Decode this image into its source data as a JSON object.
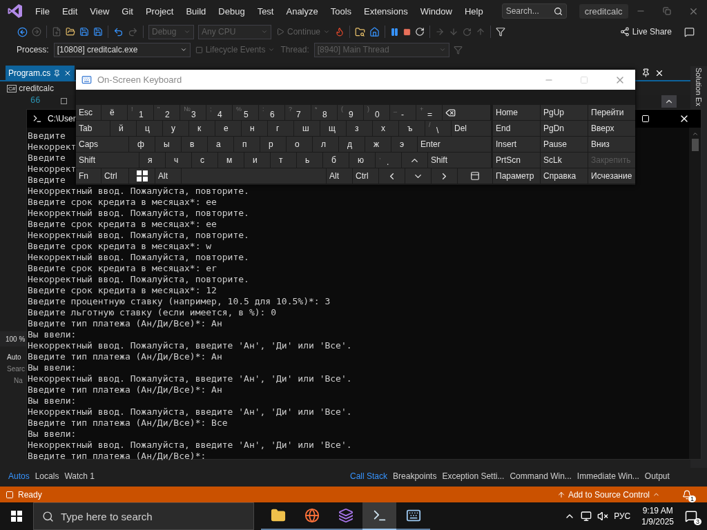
{
  "menu_bar": {
    "items": [
      "File",
      "Edit",
      "View",
      "Git",
      "Project",
      "Build",
      "Debug",
      "Test",
      "Analyze",
      "Tools",
      "Extensions",
      "Window",
      "Help"
    ],
    "search": {
      "placeholder": "Search..."
    },
    "title": "creditcalc"
  },
  "toolbar": {
    "configuration": {
      "value": "Debug",
      "disabled": true
    },
    "platform": {
      "value": "Any CPU",
      "disabled": true
    },
    "continue": {
      "label": "Continue",
      "disabled": true
    },
    "live_share": "Live Share"
  },
  "debug_location": {
    "process_label": "Process:",
    "process": "[10808] creditcalc.exe",
    "lifecycle": {
      "label": "Lifecycle Events",
      "disabled": true
    },
    "thread_label": {
      "label": "Thread:",
      "disabled": true
    },
    "thread": {
      "value": "[8940] Main Thread",
      "disabled": true
    }
  },
  "document_tab": {
    "label": "Program.cs",
    "selected": true
  },
  "navigation": {
    "language_badge": "C#",
    "project": "creditcalc"
  },
  "editor": {
    "line_number": "66",
    "zoom": "100 %"
  },
  "autos_panel": {
    "title": "Auto",
    "search": "Searc",
    "column_1": "Na"
  },
  "solution_explorer": {
    "title": "Solution Ex"
  },
  "bottom_tabs_left": [
    {
      "label": "Autos",
      "selected": true
    },
    {
      "label": "Locals",
      "selected": false
    },
    {
      "label": "Watch 1",
      "selected": false
    }
  ],
  "bottom_tabs_right": [
    {
      "label": "Call Stack",
      "selected": true
    },
    {
      "label": "Breakpoints",
      "selected": false
    },
    {
      "label": "Exception Setti...",
      "selected": false
    },
    {
      "label": "Command Win...",
      "selected": false
    },
    {
      "label": "Immediate Win...",
      "selected": false
    },
    {
      "label": "Output",
      "selected": false
    }
  ],
  "status_bar": {
    "text": "Ready",
    "source_control": "Add to Source Control",
    "notifications": "1"
  },
  "console": {
    "title": "C:\\User",
    "lines": [
      "Введите",
      "Некоррект",
      "Введите",
      "Некоррект",
      "Введите",
      "Некорректный ввод. Пожалуйста, повторите.",
      "Введите срок кредита в месяцах*: ee",
      "Некорректный ввод. Пожалуйста, повторите.",
      "Введите срок кредита в месяцах*: ee",
      "Некорректный ввод. Пожалуйста, повторите.",
      "Введите срок кредита в месяцах*: w",
      "Некорректный ввод. Пожалуйста, повторите.",
      "Введите срок кредита в месяцах*: er",
      "Некорректный ввод. Пожалуйста, повторите.",
      "Введите срок кредита в месяцах*: 12",
      "Введите процентную ставку (например, 10.5 для 10.5%)*: 3",
      "Введите льготную ставку (если имеется, в %): 0",
      "Введите тип платежа (Ан/Ди/Все)*: Ан",
      "Вы ввели:",
      "Некорректный ввод. Пожалуйста, введите 'Ан', 'Ди' или 'Все'.",
      "Введите тип платежа (Ан/Ди/Все)*: Ан",
      "Вы ввели:",
      "Некорректный ввод. Пожалуйста, введите 'Ан', 'Ди' или 'Все'.",
      "Введите тип платежа (Ан/Ди/Все)*: Ан",
      "Вы ввели:",
      "Некорректный ввод. Пожалуйста, введите 'Ан', 'Ди' или 'Все'.",
      "Введите тип платежа (Ан/Ди/Все)*: Все",
      "Вы ввели:",
      "Некорректный ввод. Пожалуйста, введите 'Ан', 'Ди' или 'Все'.",
      "Введите тип платежа (Ан/Ди/Все)*:"
    ]
  },
  "keyboard": {
    "title": "On-Screen Keyboard",
    "rows": [
      [
        {
          "kind": "text",
          "label": "Esc"
        },
        {
          "kind": "char",
          "label": "ё"
        },
        {
          "kind": "char",
          "label": "1",
          "shift": "!"
        },
        {
          "kind": "char",
          "label": "2",
          "shift": "\""
        },
        {
          "kind": "char",
          "label": "3",
          "shift": "№"
        },
        {
          "kind": "char",
          "label": "4",
          "shift": ";"
        },
        {
          "kind": "char",
          "label": "5",
          "shift": "%"
        },
        {
          "kind": "char",
          "label": "6",
          "shift": ":"
        },
        {
          "kind": "char",
          "label": "7",
          "shift": "?"
        },
        {
          "kind": "char",
          "label": "8",
          "shift": "*"
        },
        {
          "kind": "char",
          "label": "9",
          "shift": "("
        },
        {
          "kind": "char",
          "label": "0",
          "shift": ")"
        },
        {
          "kind": "char",
          "label": "-",
          "shift": "_"
        },
        {
          "kind": "char",
          "label": "=",
          "shift": "+"
        },
        {
          "kind": "backspace"
        }
      ],
      [
        {
          "kind": "text",
          "label": "Tab"
        },
        {
          "kind": "char",
          "label": "й"
        },
        {
          "kind": "char",
          "label": "ц"
        },
        {
          "kind": "char",
          "label": "у"
        },
        {
          "kind": "char",
          "label": "к"
        },
        {
          "kind": "char",
          "label": "е"
        },
        {
          "kind": "char",
          "label": "н"
        },
        {
          "kind": "char",
          "label": "г"
        },
        {
          "kind": "char",
          "label": "ш"
        },
        {
          "kind": "char",
          "label": "щ"
        },
        {
          "kind": "char",
          "label": "з"
        },
        {
          "kind": "char",
          "label": "х"
        },
        {
          "kind": "char",
          "label": "ъ"
        },
        {
          "kind": "char",
          "label": "\\",
          "shift": "/"
        },
        {
          "kind": "text",
          "label": "Del"
        }
      ],
      [
        {
          "kind": "text",
          "label": "Caps"
        },
        {
          "kind": "char",
          "label": "ф"
        },
        {
          "kind": "char",
          "label": "ы"
        },
        {
          "kind": "char",
          "label": "в"
        },
        {
          "kind": "char",
          "label": "а"
        },
        {
          "kind": "char",
          "label": "п"
        },
        {
          "kind": "char",
          "label": "р"
        },
        {
          "kind": "char",
          "label": "о"
        },
        {
          "kind": "char",
          "label": "л"
        },
        {
          "kind": "char",
          "label": "д"
        },
        {
          "kind": "char",
          "label": "ж"
        },
        {
          "kind": "char",
          "label": "э"
        },
        {
          "kind": "text",
          "label": "Enter"
        }
      ],
      [
        {
          "kind": "text",
          "label": "Shift"
        },
        {
          "kind": "char",
          "label": "я"
        },
        {
          "kind": "char",
          "label": "ч"
        },
        {
          "kind": "char",
          "label": "с"
        },
        {
          "kind": "char",
          "label": "м"
        },
        {
          "kind": "char",
          "label": "и"
        },
        {
          "kind": "char",
          "label": "т"
        },
        {
          "kind": "char",
          "label": "ь"
        },
        {
          "kind": "char",
          "label": "б"
        },
        {
          "kind": "char",
          "label": "ю"
        },
        {
          "kind": "char",
          "label": ".",
          "shift": ","
        },
        {
          "kind": "arrow-up"
        },
        {
          "kind": "text",
          "label": "Shift"
        }
      ],
      [
        {
          "kind": "text",
          "label": "Fn"
        },
        {
          "kind": "text",
          "label": "Ctrl"
        },
        {
          "kind": "windows"
        },
        {
          "kind": "text",
          "label": "Alt"
        },
        {
          "kind": "space"
        },
        {
          "kind": "text",
          "label": "Alt"
        },
        {
          "kind": "text",
          "label": "Ctrl"
        },
        {
          "kind": "arrow-left"
        },
        {
          "kind": "arrow-down"
        },
        {
          "kind": "arrow-right"
        },
        {
          "kind": "menu"
        }
      ]
    ],
    "nav_rows": [
      [
        {
          "label": "Home",
          "disabled": false
        },
        {
          "label": "PgUp",
          "disabled": false
        },
        {
          "label": "Перейти",
          "disabled": false
        }
      ],
      [
        {
          "label": "End",
          "disabled": false
        },
        {
          "label": "PgDn",
          "disabled": false
        },
        {
          "label": "Вверх",
          "disabled": false
        }
      ],
      [
        {
          "label": "Insert",
          "disabled": false
        },
        {
          "label": "Pause",
          "disabled": false
        },
        {
          "label": "Вниз",
          "disabled": false
        }
      ],
      [
        {
          "label": "PrtScn",
          "disabled": false
        },
        {
          "label": "ScLk",
          "disabled": false
        },
        {
          "label": "Закрепить",
          "disabled": true
        }
      ],
      [
        {
          "label": "Параметр",
          "disabled": false
        },
        {
          "label": "Справка",
          "disabled": false
        },
        {
          "label": "Исчезание",
          "disabled": false
        }
      ]
    ]
  },
  "taskbar": {
    "search": {
      "placeholder": "Type here to search"
    },
    "apps": [
      {
        "kind": "folder",
        "selected": false
      },
      {
        "kind": "browser",
        "selected": false
      },
      {
        "kind": "ide",
        "selected": false
      },
      {
        "kind": "console",
        "selected": true
      },
      {
        "kind": "keyboard",
        "selected": false
      }
    ],
    "tray": {
      "language": "РУС",
      "time": "9:19 AM",
      "date": "1/9/2025",
      "notifications": "3"
    }
  }
}
